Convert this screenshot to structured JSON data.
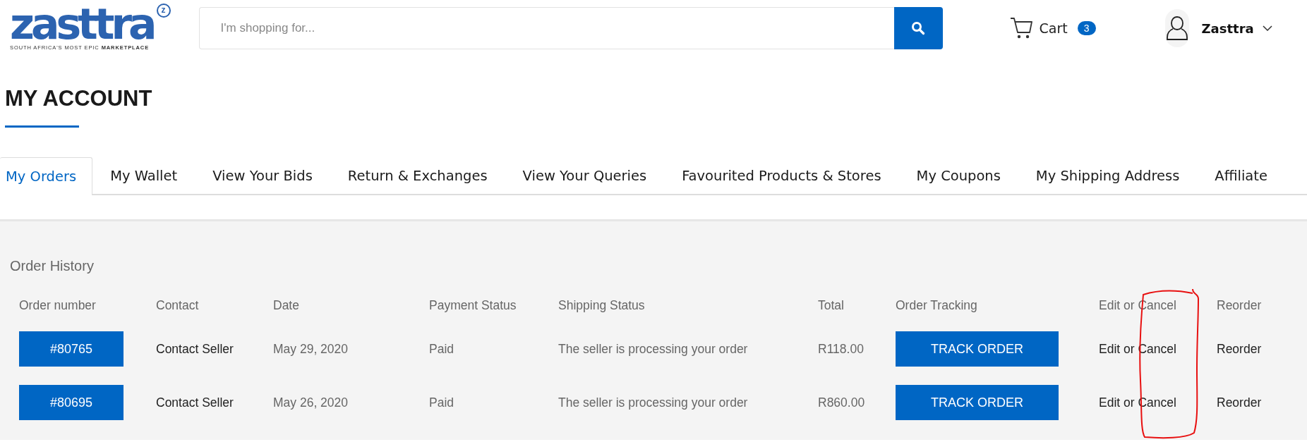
{
  "header": {
    "logo": {
      "name": "zasttra",
      "mark": "z",
      "tagline": "SOUTH AFRICA'S MOST EPIC **MARKETPLACE**"
    },
    "search": {
      "placeholder": "I'm shopping for..."
    },
    "cart": {
      "label": "Cart",
      "count": "3"
    },
    "user": {
      "name": "Zasttra"
    }
  },
  "page_title": "MY ACCOUNT",
  "tabs": [
    {
      "label": "My Orders",
      "selected": true
    },
    {
      "label": "My Wallet",
      "selected": false
    },
    {
      "label": "View Your Bids",
      "selected": false
    },
    {
      "label": "Return & Exchanges",
      "selected": false
    },
    {
      "label": "View Your Queries",
      "selected": false
    },
    {
      "label": "Favourited Products & Stores",
      "selected": false
    },
    {
      "label": "My Coupons",
      "selected": false
    },
    {
      "label": "My Shipping Address",
      "selected": false
    },
    {
      "label": "Affiliate",
      "selected": false
    }
  ],
  "order_history": {
    "title": "Order History",
    "columns": [
      "Order number",
      "Contact",
      "Date",
      "Payment Status",
      "Shipping Status",
      "Total",
      "Order Tracking",
      "Edit or Cancel",
      "Reorder"
    ],
    "rows": [
      {
        "order": "#80765",
        "contact": "Contact Seller",
        "date": "May 29, 2020",
        "payment": "Paid",
        "shipping": "The seller is processing your order",
        "total": "R118.00",
        "tracking": "TRACK ORDER",
        "edit": "Edit or Cancel",
        "reorder": "Reorder"
      },
      {
        "order": "#80695",
        "contact": "Contact Seller",
        "date": "May 26, 2020",
        "payment": "Paid",
        "shipping": "The seller is processing your order",
        "total": "R860.00",
        "tracking": "TRACK ORDER",
        "edit": "Edit or Cancel",
        "reorder": "Reorder"
      }
    ]
  }
}
